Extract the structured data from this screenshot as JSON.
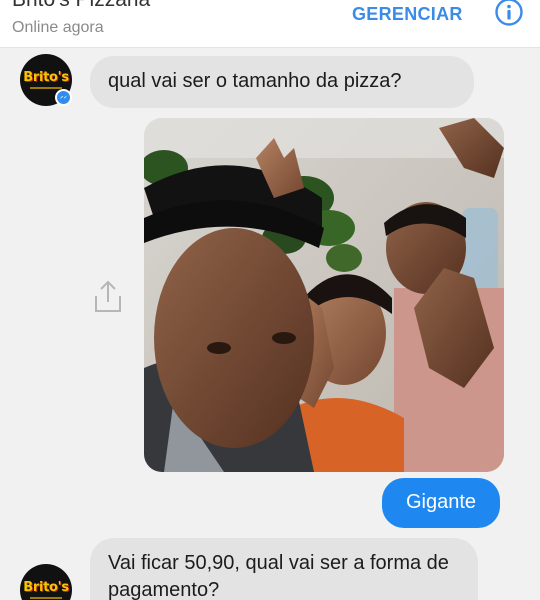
{
  "header": {
    "contact_name": "Brito's Pizzaria",
    "status": "Online agora",
    "manage_label": "GERENCIAR",
    "info_icon": "info-icon"
  },
  "colors": {
    "accent": "#1e88f0",
    "header_link": "#3b8be8",
    "incoming_bubble": "#e3e3e3",
    "background": "#f1f1f1",
    "logo_yellow": "#f6c400"
  },
  "avatar": {
    "logo_text": "Brito's"
  },
  "messages": [
    {
      "direction": "incoming",
      "type": "text",
      "text": "qual vai ser o tamanho da pizza?"
    },
    {
      "direction": "outgoing",
      "type": "image",
      "icon": "photo-image"
    },
    {
      "direction": "outgoing",
      "type": "text",
      "text": "Gigante"
    },
    {
      "direction": "incoming",
      "type": "text",
      "text": "Vai ficar 50,90, qual vai ser a forma de pagamento?"
    }
  ],
  "share_icon": "share-icon"
}
